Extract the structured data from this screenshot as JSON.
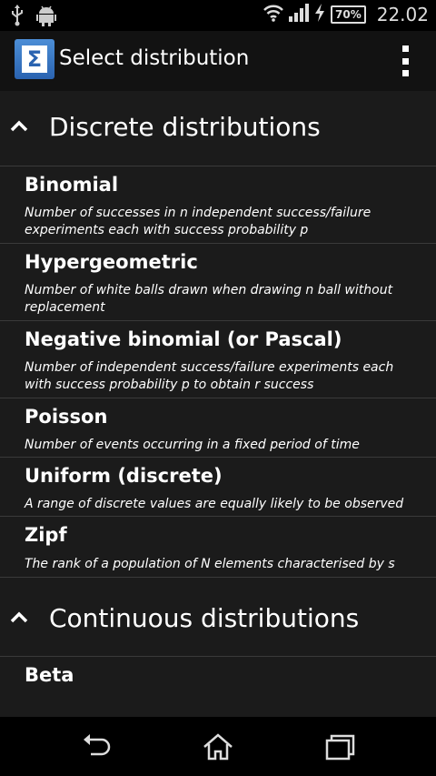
{
  "status_bar": {
    "battery": "70%",
    "time": "22.02",
    "left_icons": [
      "usb-icon",
      "android-icon"
    ],
    "right_icons": [
      "wifi-icon",
      "signal-icon",
      "charging-icon"
    ]
  },
  "action_bar": {
    "title": "Select distribution",
    "app_icon_glyph": "Σ"
  },
  "groups": [
    {
      "label": "Discrete distributions",
      "items": [
        {
          "name": "Binomial",
          "description": "Number of successes in n independent success/failure experiments each with success probability p"
        },
        {
          "name": "Hypergeometric",
          "description": "Number of white balls drawn when drawing n ball without replacement"
        },
        {
          "name": "Negative binomial (or Pascal)",
          "description": "Number of independent success/failure experiments each with success probability p to obtain r success"
        },
        {
          "name": "Poisson",
          "description": "Number of events occurring in a fixed period of time"
        },
        {
          "name": "Uniform (discrete)",
          "description": "A range of discrete values are equally likely to be observed"
        },
        {
          "name": "Zipf",
          "description": "The rank of a population of N elements characterised by s"
        }
      ]
    },
    {
      "label": "Continuous distributions",
      "items": [
        {
          "name": "Beta",
          "description": ""
        }
      ]
    }
  ],
  "nav_bar": {
    "buttons": [
      "back-icon",
      "home-icon",
      "recent-apps-icon"
    ]
  }
}
